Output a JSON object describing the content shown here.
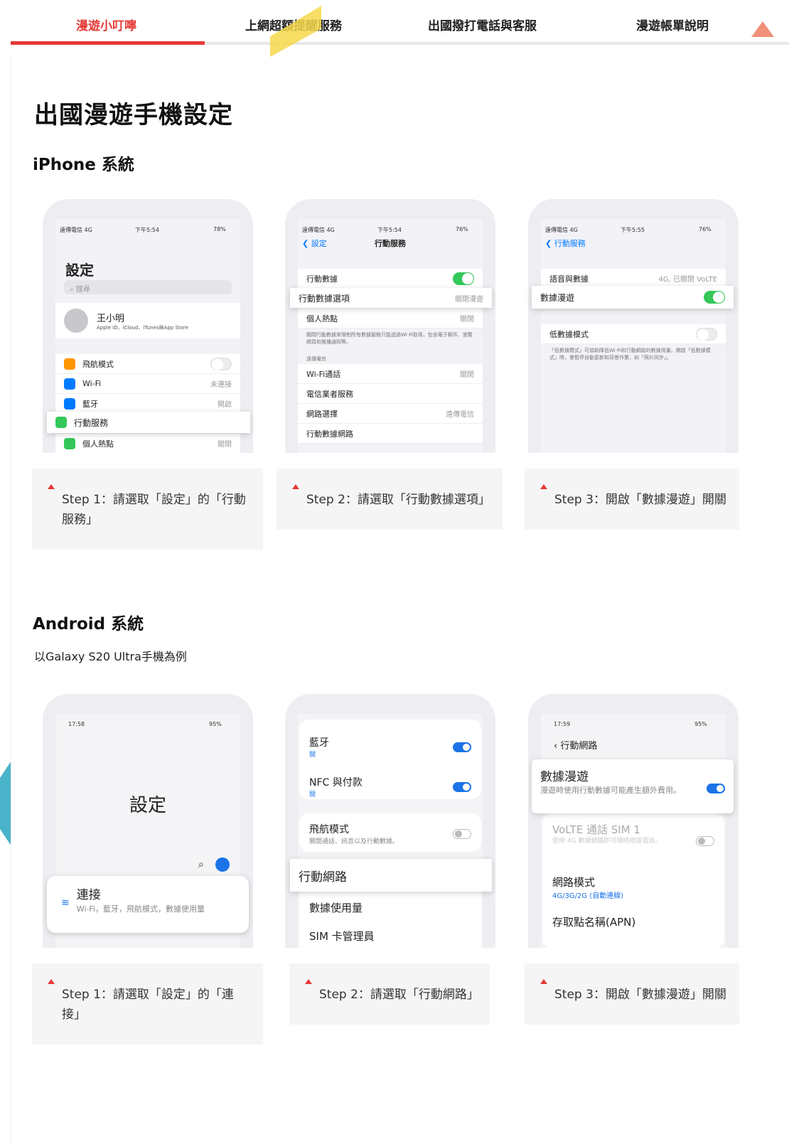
{
  "tabs": [
    "漫遊小叮嚀",
    "上網超額提醒服務",
    "出國撥打電話與客服",
    "漫遊帳單說明"
  ],
  "colors": {
    "accent": "#e53935",
    "toggle_ios": "#34c759",
    "toggle_android": "#1a73e8"
  },
  "page_title": "出國漫遊手機設定",
  "iphone": {
    "heading": "iPhone 系統",
    "s1": {
      "carrier": "遠傳電信 4G",
      "time": "下午5:54",
      "battery": "78%",
      "title": "設定",
      "search": "搜尋",
      "user": "王小明",
      "user_sub": "Apple ID、iCloud、iTunes與App Store",
      "rows": [
        {
          "label": "飛航模式",
          "value": ""
        },
        {
          "label": "Wi-Fi",
          "value": "未連接"
        },
        {
          "label": "藍牙",
          "value": "開啟"
        },
        {
          "label": "行動服務",
          "value": ""
        },
        {
          "label": "個人熱點",
          "value": "關閉"
        }
      ]
    },
    "s2": {
      "carrier": "遠傳電信 4G",
      "time": "下午5:54",
      "battery": "76%",
      "back": "設定",
      "title": "行動服務",
      "r1": "行動數據",
      "r2": "行動數據選項",
      "r2v": "關閉漫遊",
      "r3": "個人熱點",
      "r3v": "關閉",
      "note": "關閉行動數據來限制所有數據服務只能透過Wi-Fi取用，包含電子郵件、瀏覽網頁和推播通知等。",
      "section": "遠傳電信",
      "r4": "Wi-Fi通話",
      "r4v": "關閉",
      "r5": "電信業者服務",
      "r6": "網路選擇",
      "r6v": "遠傳電信",
      "r7": "行動數據網路"
    },
    "s3": {
      "carrier": "遠傳電信 4G",
      "time": "下午5:55",
      "battery": "76%",
      "back": "行動服務",
      "r1": "語音與數據",
      "r1v": "4G, 已關閉 VoLTE",
      "r2": "數據漫遊",
      "r3": "低數據模式",
      "note": "「低數據模式」可協助降低Wi-Fi和行動網路的數據用量。開啟「低數據模式」時，會暫停自動更新和背景作業，如「照片同步」。"
    },
    "captions": [
      "Step 1：請選取「設定」的「行動服務」",
      "Step 2：請選取「行動數據選項」",
      "Step 3：開啟「數據漫遊」開關"
    ]
  },
  "android": {
    "heading": "Android 系統",
    "subtitle": "以Galaxy S20 Ultra手機為例",
    "s1": {
      "time": "17:58",
      "battery": "95%",
      "title": "設定",
      "conn": "連接",
      "conn_sub": "Wi-Fi，藍牙，飛航模式，數據使用量"
    },
    "s2": {
      "r1": "藍牙",
      "r1s": "開",
      "r2": "NFC 與付款",
      "r2s": "開",
      "r3": "飛航模式",
      "r3s": "關閉通話、訊息以及行動數據。",
      "r4": "行動網路",
      "r5": "數據使用量",
      "r6": "SIM 卡管理員"
    },
    "s3": {
      "time": "17:59",
      "battery": "95%",
      "back": "行動網路",
      "r1": "數據漫遊",
      "r1s": "漫遊時使用行動數據可能產生額外費用。",
      "r2": "VoLTE 通話 SIM 1",
      "r2s": "使用 4G 數據網路即可隨時撥接電話。",
      "r3": "網路模式",
      "r3s": "4G/3G/2G (自動連線)",
      "r4": "存取點名稱(APN)"
    },
    "captions": [
      "Step 1：請選取「設定」的「連接」",
      "Step 2：請選取「行動網路」",
      "Step 3：開啟「數據漫遊」開關"
    ]
  }
}
